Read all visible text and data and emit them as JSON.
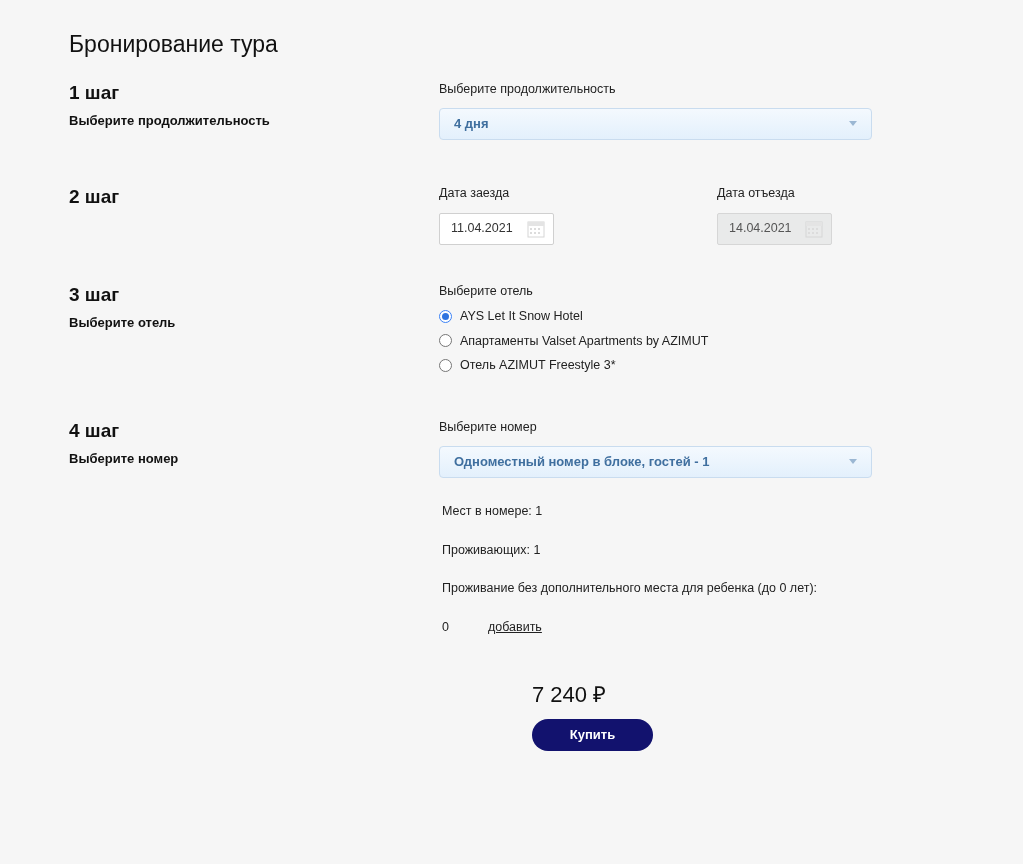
{
  "title": "Бронирование тура",
  "steps": [
    {
      "kind": "select",
      "step": "1 шаг",
      "subtitle": "Выберите продолжительность",
      "label": "Выберите продолжительность",
      "value": "4 дня"
    },
    {
      "kind": "dates",
      "step": "2 шаг",
      "fields": [
        {
          "label": "Дата заезда",
          "value": "11.04.2021",
          "disabled": false
        },
        {
          "label": "Дата отъезда",
          "value": "14.04.2021",
          "disabled": true
        }
      ]
    },
    {
      "kind": "radio",
      "step": "3 шаг",
      "subtitle": "Выберите отель",
      "label": "Выберите отель",
      "options": [
        {
          "label": "AYS Let It Snow Hotel",
          "selected": true
        },
        {
          "label": "Апартаменты Valset Apartments by AZIMUT",
          "selected": false
        },
        {
          "label": "Отель AZIMUT Freestyle 3*",
          "selected": false
        }
      ]
    },
    {
      "kind": "room",
      "step": "4 шаг",
      "subtitle": "Выберите номер",
      "label": "Выберите номер",
      "value": "Одноместный номер в блоке, гостей - 1",
      "details": [
        "Мест в номере: 1",
        "Проживающих: 1",
        "Проживание без дополнительного места для ребенка (до 0 лет):"
      ],
      "child_count": "0",
      "add_link": "добавить"
    }
  ],
  "price": "7 240 ₽",
  "buy_button": "Купить"
}
